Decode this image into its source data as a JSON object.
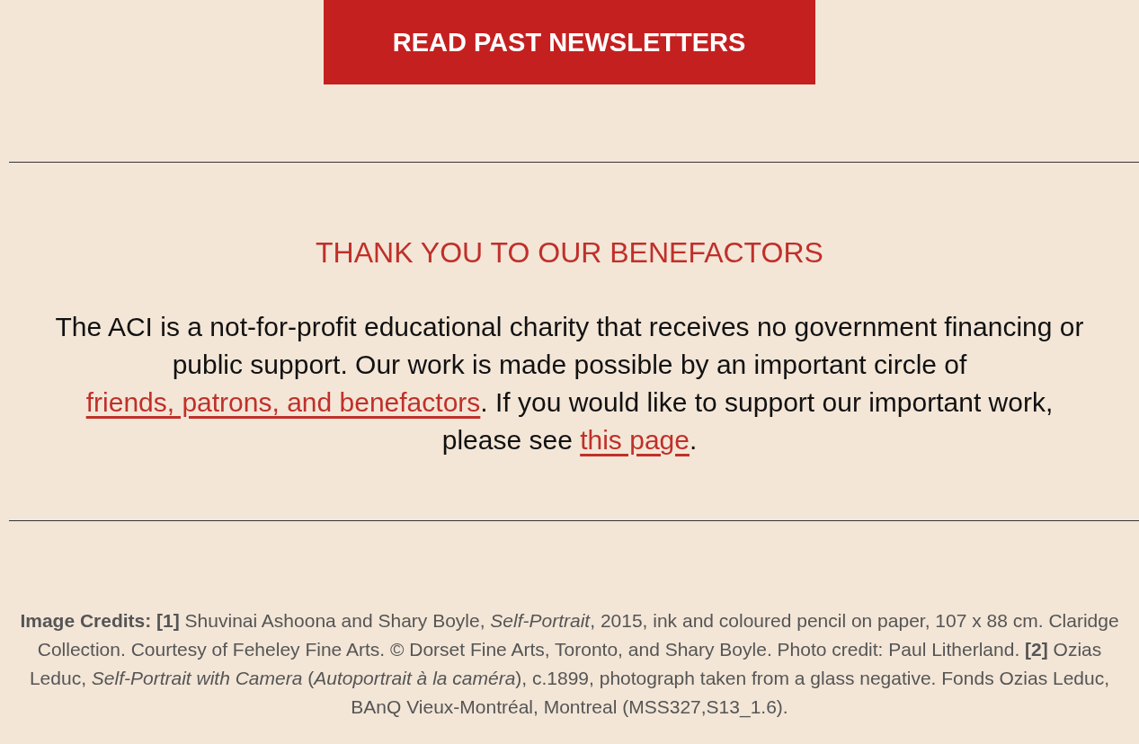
{
  "newsletter_button": {
    "label": "READ PAST NEWSLETTERS"
  },
  "benefactors": {
    "heading": "THANK YOU TO OUR BENEFACTORS",
    "paragraph": [
      {
        "kind": "text",
        "text": "The ACI is a not-for-profit educational charity that receives no government financing or public support. Our work is made possible by an important circle of "
      },
      {
        "kind": "link",
        "text": "friends, patrons, and benefactors"
      },
      {
        "kind": "text",
        "text": ". If you would like to support our important work, please see "
      },
      {
        "kind": "link",
        "text": "this page"
      },
      {
        "kind": "text",
        "text": "."
      }
    ]
  },
  "image_credits": "**Image Credits: [1]** Shuvinai Ashoona and Shary Boyle, *Self-Portrait*, 2015, ink and coloured pencil on paper, 107 x 88 cm. Claridge Collection. Courtesy of Feheley Fine Arts. © Dorset Fine Arts, Toronto, and Shary Boyle. Photo credit: Paul Litherland. **[2]** Ozias Leduc, *Self-Portrait with Camera* (*Autoportrait à la caméra*), c.1899, photograph taken from a glass negative. Fonds Ozias Leduc, BAnQ Vieux-Montréal, Montreal (MSS327,S13_1.6)."
}
